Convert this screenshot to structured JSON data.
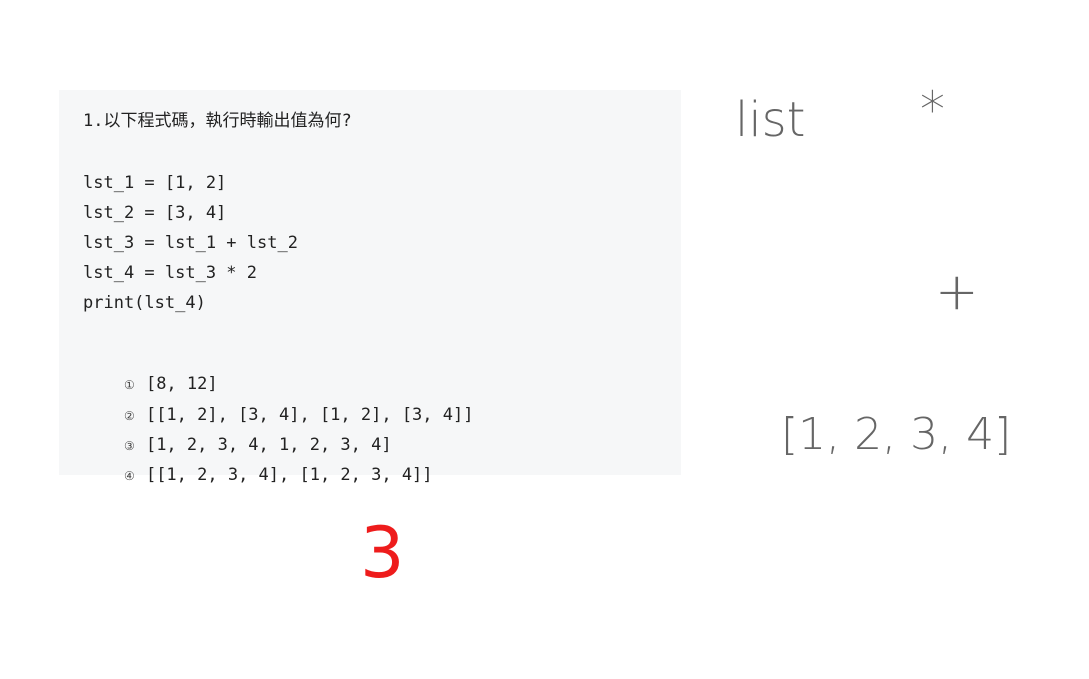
{
  "question": {
    "title": "1.以下程式碼，執行時輸出值為何?",
    "code_lines": [
      "lst_1 = [1, 2]",
      "lst_2 = [3, 4]",
      "lst_3 = lst_1 + lst_2",
      "lst_4 = lst_3 * 2",
      "print(lst_4)"
    ],
    "options": [
      {
        "marker": "①",
        "text": "[8, 12]"
      },
      {
        "marker": "②",
        "text": "[[1, 2], [3, 4], [1, 2], [3, 4]]"
      },
      {
        "marker": "③",
        "text": "[1, 2, 3, 4, 1, 2, 3, 4]"
      },
      {
        "marker": "④",
        "text": "[[1, 2, 3, 4], [1, 2, 3, 4]]"
      }
    ]
  },
  "notes": {
    "list_word": "list",
    "asterisk": "*",
    "plus": "+",
    "combined_list": "[1, 2, 3, 4]"
  },
  "answer": {
    "value": "3",
    "color": "#ee1c1c"
  }
}
